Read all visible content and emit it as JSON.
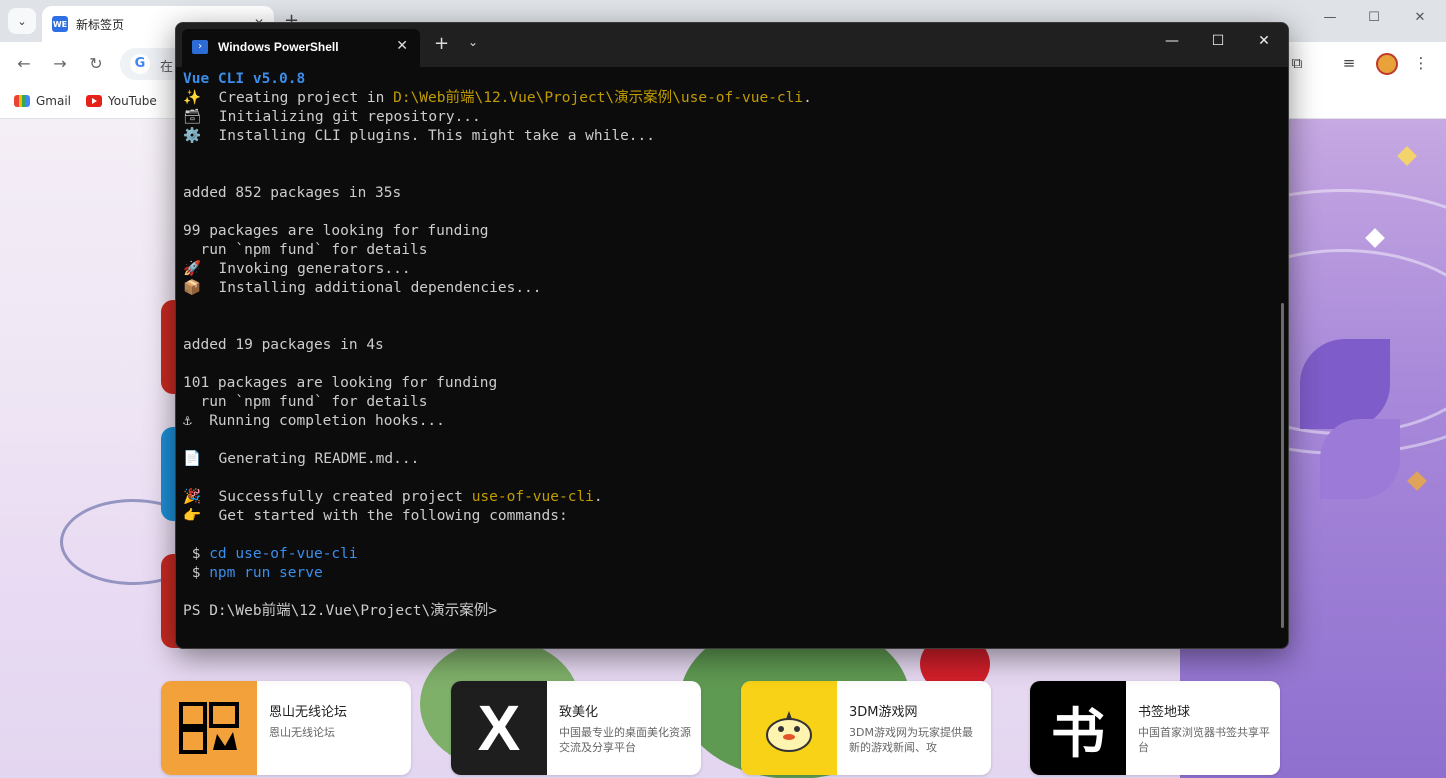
{
  "browser": {
    "tab_title": "新标签页",
    "favicon_text": "WE",
    "omnibox_text": "在",
    "bookmarks": [
      {
        "label": "Gmail",
        "icon": "gmail-icon"
      },
      {
        "label": "YouTube",
        "icon": "youtube-icon"
      }
    ]
  },
  "terminal": {
    "tab_title": "Windows PowerShell",
    "lines": [
      {
        "parts": [
          {
            "t": "Vue CLI v5.0.8",
            "c": "c-bold-blue"
          }
        ]
      },
      {
        "parts": [
          {
            "t": "✨  Creating project in "
          },
          {
            "t": "D:\\Web前端\\12.Vue\\Project\\演示案例\\use-of-vue-cli",
            "c": "c-yellow"
          },
          {
            "t": "."
          }
        ]
      },
      {
        "parts": [
          {
            "t": "🗃  Initializing git repository..."
          }
        ]
      },
      {
        "parts": [
          {
            "t": "⚙️  Installing CLI plugins. This might take a while..."
          }
        ]
      },
      {
        "parts": [
          {
            "t": ""
          }
        ]
      },
      {
        "parts": [
          {
            "t": ""
          }
        ]
      },
      {
        "parts": [
          {
            "t": "added 852 packages in 35s"
          }
        ]
      },
      {
        "parts": [
          {
            "t": ""
          }
        ]
      },
      {
        "parts": [
          {
            "t": "99 packages are looking for funding"
          }
        ]
      },
      {
        "parts": [
          {
            "t": "  run `npm fund` for details"
          }
        ]
      },
      {
        "parts": [
          {
            "t": "🚀  Invoking generators..."
          }
        ]
      },
      {
        "parts": [
          {
            "t": "📦  Installing additional dependencies..."
          }
        ]
      },
      {
        "parts": [
          {
            "t": ""
          }
        ]
      },
      {
        "parts": [
          {
            "t": ""
          }
        ]
      },
      {
        "parts": [
          {
            "t": "added 19 packages in 4s"
          }
        ]
      },
      {
        "parts": [
          {
            "t": ""
          }
        ]
      },
      {
        "parts": [
          {
            "t": "101 packages are looking for funding"
          }
        ]
      },
      {
        "parts": [
          {
            "t": "  run `npm fund` for details"
          }
        ]
      },
      {
        "parts": [
          {
            "t": "⚓  Running completion hooks..."
          }
        ]
      },
      {
        "parts": [
          {
            "t": ""
          }
        ]
      },
      {
        "parts": [
          {
            "t": "📄  Generating README.md..."
          }
        ]
      },
      {
        "parts": [
          {
            "t": ""
          }
        ]
      },
      {
        "parts": [
          {
            "t": "🎉  Successfully created project "
          },
          {
            "t": "use-of-vue-cli",
            "c": "c-yellow"
          },
          {
            "t": "."
          }
        ]
      },
      {
        "parts": [
          {
            "t": "👉  Get started with the following commands:"
          }
        ]
      },
      {
        "parts": [
          {
            "t": ""
          }
        ]
      },
      {
        "parts": [
          {
            "t": " $ "
          },
          {
            "t": "cd use-of-vue-cli",
            "c": "c-blue"
          }
        ]
      },
      {
        "parts": [
          {
            "t": " $ "
          },
          {
            "t": "npm run serve",
            "c": "c-blue"
          }
        ]
      },
      {
        "parts": [
          {
            "t": ""
          }
        ]
      },
      {
        "parts": [
          {
            "t": "PS D:\\Web前端\\12.Vue\\Project\\演示案例>"
          }
        ]
      }
    ]
  },
  "shortcuts": [
    {
      "title": "恩山无线论坛",
      "desc": "恩山无线论坛",
      "icon": "enshan-logo-icon",
      "icon_bg": "#f3a13b"
    },
    {
      "title": "致美化",
      "desc": "中国最专业的桌面美化资源交流及分享平台",
      "icon_text": "X",
      "icon": "zhimeihua-x-icon",
      "icon_bg": "#1e1e1e"
    },
    {
      "title": "3DM游戏网",
      "desc": "3DM游戏网为玩家提供最新的游戏新闻、攻",
      "icon": "3dm-duck-icon",
      "icon_bg": "#f7d216"
    },
    {
      "title": "书签地球",
      "desc": "中国首家浏览器书签共享平台",
      "icon_text": "书",
      "icon": "shuqian-book-icon",
      "icon_bg": "#000000"
    }
  ]
}
